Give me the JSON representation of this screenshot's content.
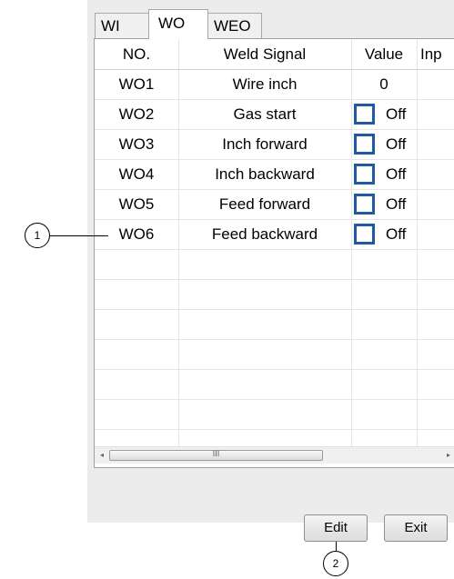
{
  "tabs": [
    {
      "label": "WI",
      "active": false
    },
    {
      "label": "WO",
      "active": true
    },
    {
      "label": "WEO",
      "active": false
    }
  ],
  "table": {
    "headers": [
      "NO.",
      "Weld Signal",
      "Value",
      "Inp"
    ],
    "rows": [
      {
        "no": "WO1",
        "signal": "Wire inch",
        "value": "0"
      },
      {
        "no": "WO2",
        "signal": "Gas start",
        "value": "Off"
      },
      {
        "no": "WO3",
        "signal": "Inch forward",
        "value": "Off"
      },
      {
        "no": "WO4",
        "signal": "Inch backward",
        "value": "Off"
      },
      {
        "no": "WO5",
        "signal": "Feed forward",
        "value": "Off"
      },
      {
        "no": "WO6",
        "signal": "Feed backward",
        "value": "Off"
      }
    ]
  },
  "scrollbar": {
    "left_arrow": "◂",
    "right_arrow": "▸",
    "thumb_grip": "III"
  },
  "buttons": {
    "edit": "Edit",
    "exit": "Exit"
  },
  "callouts": [
    "1",
    "2"
  ],
  "colors": {
    "checkbox_border": "#1f5aa6",
    "panel_bg": "#ececec",
    "grid_line": "#e6e6e6"
  }
}
